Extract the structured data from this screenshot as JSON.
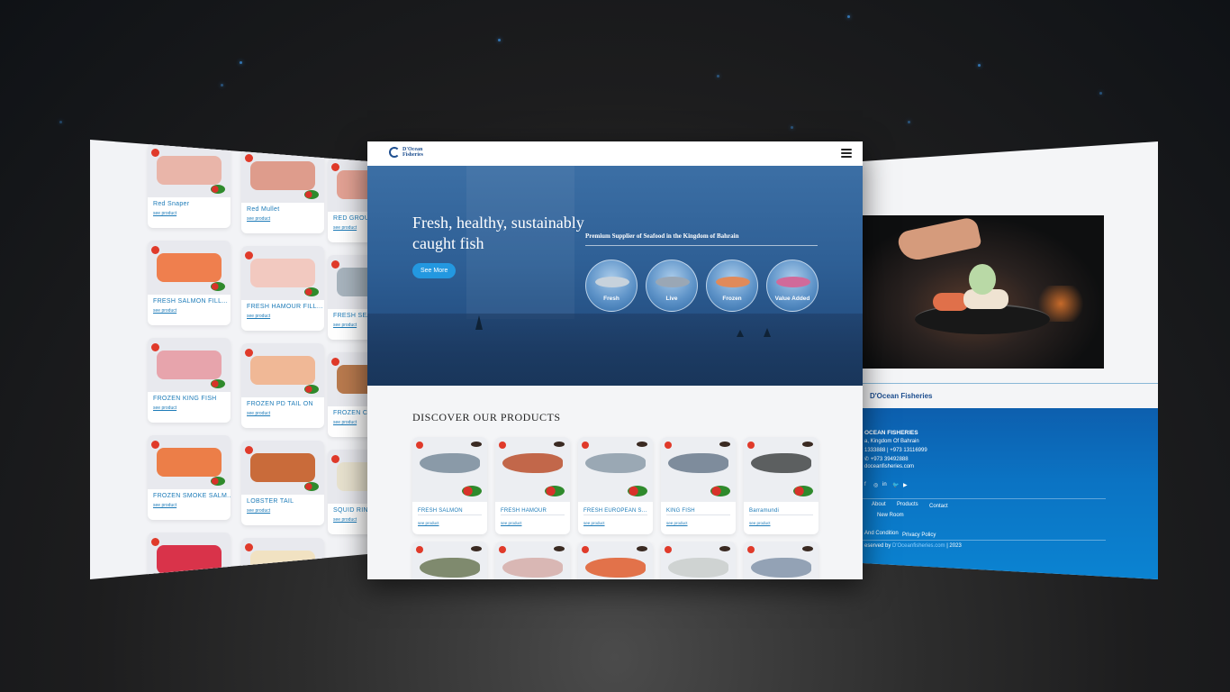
{
  "main": {
    "logo_text": "D'Ocean\nFisheries",
    "hero": {
      "title": "Fresh, healthy, sustainably caught fish",
      "button": "See More",
      "subtitle": "Premium Supplier of Seafood in the Kingdom of Bahrain",
      "categories": [
        {
          "label": "Fresh",
          "color": "#c7d2dc"
        },
        {
          "label": "Live",
          "color": "#9aa7b5"
        },
        {
          "label": "Frozen",
          "color": "#e08a5a"
        },
        {
          "label": "Value Added",
          "color": "#d06a9a"
        }
      ]
    },
    "products": {
      "heading": "DISCOVER OUR PRODUCTS",
      "link_label": "see product",
      "items": [
        {
          "name": "FRESH SALMON",
          "color": "#8a9aa8"
        },
        {
          "name": "FRESH HAMOUR",
          "color": "#c2674a"
        },
        {
          "name": "FRESH EUROPEAN SE...",
          "color": "#9aa8b4"
        },
        {
          "name": "KING FISH",
          "color": "#7e8c9c"
        },
        {
          "name": "Barramundi",
          "color": "#5c5f60"
        },
        {
          "name": "",
          "color": "#7f8a6e"
        },
        {
          "name": "",
          "color": "#d9b7b4"
        },
        {
          "name": "",
          "color": "#e2724a"
        },
        {
          "name": "",
          "color": "#cfd3d2"
        },
        {
          "name": "",
          "color": "#93a2b5"
        }
      ]
    }
  },
  "left_panel": {
    "link_label": "see product",
    "col1": [
      {
        "name": "Red Snaper",
        "color": "#e9b5a9"
      },
      {
        "name": "FRESH SALMON FILL...",
        "color": "#ef7f4e"
      },
      {
        "name": "FROZEN KING FISH",
        "color": "#e7a4ac"
      },
      {
        "name": "FROZEN SMOKE SALM...",
        "color": "#ec7e48"
      },
      {
        "name": "",
        "color": "#d9334a"
      }
    ],
    "col2": [
      {
        "name": "Red Mullet",
        "color": "#de9c8c"
      },
      {
        "name": "FRESH HAMOUR FILL...",
        "color": "#f2c9c0"
      },
      {
        "name": "FROZEN PD TAIL ON",
        "color": "#f0b896"
      },
      {
        "name": "LOBSTER TAIL",
        "color": "#c96b3a"
      },
      {
        "name": "",
        "color": "#f1e2c2"
      }
    ],
    "col3": [
      {
        "name": "RED GROUPE...",
        "color": "#e3a294"
      },
      {
        "name": "FRESH SEABA...",
        "color": "#a8b4be"
      },
      {
        "name": "FROZEN CR...",
        "color": "#b97a4e"
      },
      {
        "name": "SQUID RING...",
        "color": "#e8e2cf"
      }
    ]
  },
  "right_panel": {
    "logo_text": "D'Ocean Fisheries",
    "company": "OCEAN FISHERIES",
    "address": "a, Kingdom Of Bahrain",
    "phones": "1333888 | +973 13116999",
    "phone2": "+973 39492888",
    "email": "doceanfisheries.com",
    "social": [
      "f",
      "◎",
      "in",
      "🐦",
      "▶"
    ],
    "nav": [
      "About",
      "Products",
      "Contact"
    ],
    "nav2": "New Room",
    "terms": "And Condition",
    "privacy": "Privacy Policy",
    "copyright_pre": "eserved by",
    "copyright_link": "D'Oceanfisheries.com",
    "copyright_year": "| 2023"
  }
}
